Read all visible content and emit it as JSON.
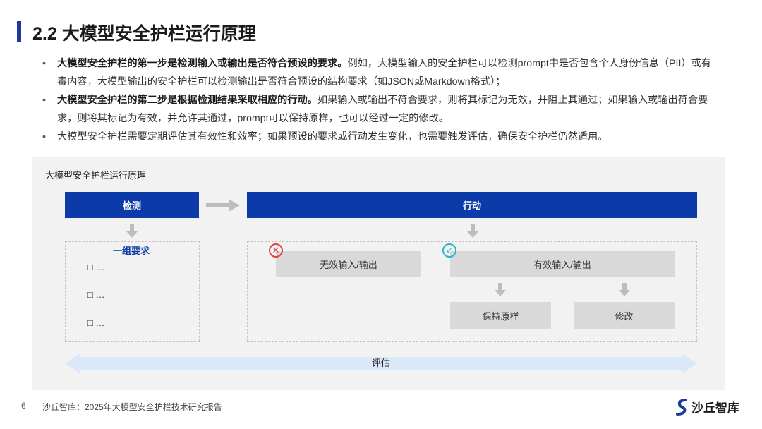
{
  "header": {
    "title": "2.2 大模型安全护栏运行原理"
  },
  "bullets": [
    {
      "bold": "大模型安全护栏的第一步是检测输入或输出是否符合预设的要求。",
      "text": "例如，大模型输入的安全护栏可以检测prompt中是否包含个人身份信息（PII）或有毒内容，大模型输出的安全护栏可以检测输出是否符合预设的结构要求（如JSON或Markdown格式）；"
    },
    {
      "bold": "大模型安全护栏的第二步是根据检测结果采取相应的行动。",
      "text": "如果输入或输出不符合要求，则将其标记为无效，并阻止其通过；如果输入或输出符合要求，则将其标记为有效，并允许其通过，prompt可以保持原样，也可以经过一定的修改。"
    },
    {
      "bold": "",
      "text": "大模型安全护栏需要定期评估其有效性和效率；如果预设的要求或行动发生变化，也需要触发评估，确保安全护栏仍然适用。"
    }
  ],
  "diagram": {
    "title": "大模型安全护栏运行原理",
    "detect_label": "检测",
    "action_label": "行动",
    "requirements": {
      "title": "一组要求",
      "items": [
        "□ …",
        "□ …",
        "□ …"
      ]
    },
    "invalid_label": "无效输入/输出",
    "valid_label": "有效输入/输出",
    "keep_label": "保持原样",
    "modify_label": "修改",
    "evaluate_label": "评估",
    "invalid_icon": "x-circle-icon",
    "valid_icon": "check-circle-icon",
    "colors": {
      "primary": "#0c3aa8",
      "invalid": "#d94444",
      "valid": "#2bb6c6",
      "eval": "#dbe8f8"
    }
  },
  "footer": {
    "page": "6",
    "source": "沙丘智库：2025年大模型安全护栏技术研究报告",
    "brand": "沙丘智库"
  }
}
